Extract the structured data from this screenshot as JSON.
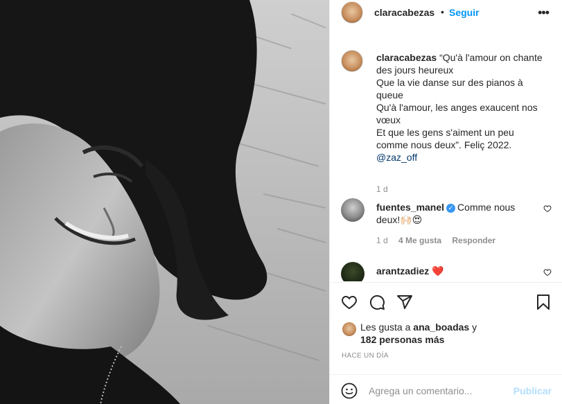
{
  "post": {
    "author": "claracabezas",
    "dot": "•",
    "follow_label": "Seguir",
    "more_label": "•••"
  },
  "caption": {
    "author": "claracabezas",
    "lines": [
      "“Qu'à l'amour on chante",
      "des jours heureux",
      "Que la vie danse sur des pianos à",
      "queue",
      "Qu'à l'amour, les anges exaucent nos",
      "vœux",
      "Et que les gens s'aiment un peu",
      "comme nous deux”. Feliç 2022."
    ],
    "mention": "@zaz_off",
    "time": "1 d"
  },
  "comments": [
    {
      "author": "fuentes_manel",
      "verified": true,
      "text": "Comme nous deux!",
      "emoji": "🙌🏻😍",
      "time": "1 d",
      "likes": "4 Me gusta",
      "reply_label": "Responder"
    },
    {
      "author": "arantzadiez",
      "text": "❤️"
    }
  ],
  "icons": {
    "like": "heart-icon",
    "comment": "comment-icon",
    "share": "share-icon",
    "save": "bookmark-icon",
    "emoji": "emoji-icon",
    "more": "more-icon"
  },
  "likes": {
    "prefix": "Les gusta a ",
    "user": "ana_boadas",
    "middle": " y",
    "others": "182 personas más"
  },
  "timestamp": "HACE UN DÍA",
  "add_comment": {
    "placeholder": "Agrega un comentario...",
    "publish_label": "Publicar"
  },
  "colors": {
    "accent": "#0095f6",
    "publish_disabled": "#b2dffc",
    "muted": "#8e8e8e",
    "heart_red": "#ed4956"
  }
}
